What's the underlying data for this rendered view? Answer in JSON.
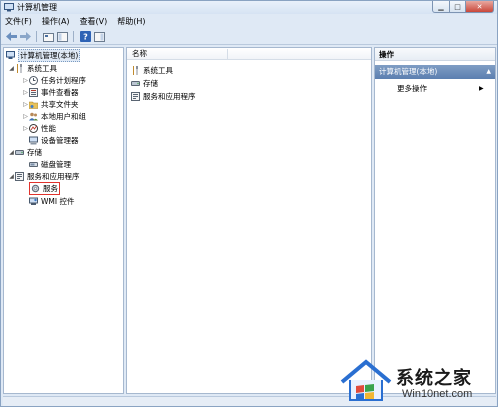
{
  "window": {
    "title": "计算机管理"
  },
  "menu": [
    {
      "label": "文件(F)"
    },
    {
      "label": "操作(A)"
    },
    {
      "label": "查看(V)"
    },
    {
      "label": "帮助(H)"
    }
  ],
  "tree": {
    "root": "计算机管理(本地)",
    "system_tools": "系统工具",
    "task_scheduler": "任务计划程序",
    "event_viewer": "事件查看器",
    "shared_folders": "共享文件夹",
    "local_users": "本地用户和组",
    "performance": "性能",
    "device_manager": "设备管理器",
    "storage": "存储",
    "disk_management": "磁盘管理",
    "services_apps": "服务和应用程序",
    "services": "服务",
    "wmi": "WMI 控件"
  },
  "center": {
    "column_name": "名称",
    "items": [
      {
        "label": "系统工具"
      },
      {
        "label": "存储"
      },
      {
        "label": "服务和应用程序"
      }
    ]
  },
  "actions": {
    "header": "操作",
    "section": "计算机管理(本地)",
    "more": "更多操作"
  },
  "watermark": {
    "title": "系统之家",
    "subtitle": "Win10net.com"
  },
  "colors": {
    "highlight_border": "#e0322c",
    "action_section": "#5b7fb0"
  }
}
